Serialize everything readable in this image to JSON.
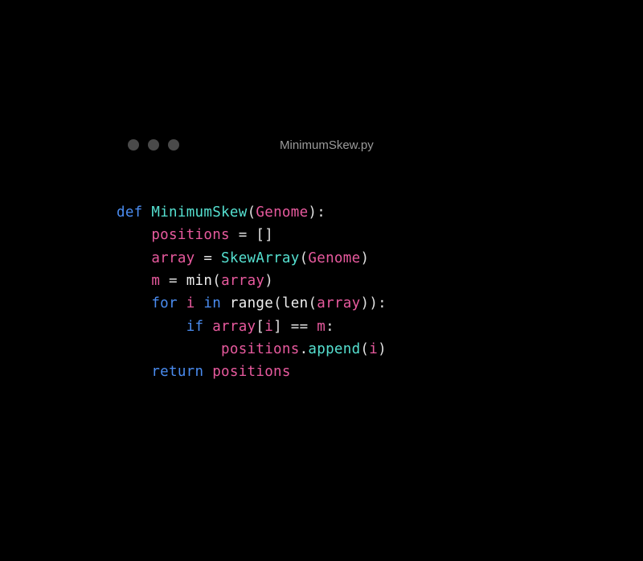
{
  "window": {
    "title": "MinimumSkew.py"
  },
  "code": {
    "line1": {
      "def": "def",
      "fname": "MinimumSkew",
      "lparen": "(",
      "param": "Genome",
      "rparen_colon": "):"
    },
    "line2": {
      "indent": "    ",
      "var": "positions",
      "eq": " = ",
      "brackets": "[]"
    },
    "line3": {
      "indent": "    ",
      "var": "array",
      "eq": " = ",
      "fn": "SkewArray",
      "lparen": "(",
      "arg": "Genome",
      "rparen": ")"
    },
    "line4": {
      "indent": "    ",
      "var": "m",
      "eq": " = ",
      "fn": "min",
      "lparen": "(",
      "arg": "array",
      "rparen": ")"
    },
    "line5": {
      "indent": "    ",
      "for": "for",
      "sp1": " ",
      "i": "i",
      "sp2": " ",
      "in": "in",
      "sp3": " ",
      "range": "range",
      "lparen1": "(",
      "len": "len",
      "lparen2": "(",
      "arr": "array",
      "rparen2": ")",
      "rparen1_colon": "):"
    },
    "line6": {
      "indent": "        ",
      "if": "if",
      "sp": " ",
      "arr": "array",
      "lbracket": "[",
      "i": "i",
      "rbracket": "]",
      "eqeq": " == ",
      "m": "m",
      "colon": ":"
    },
    "line7": {
      "indent": "            ",
      "var": "positions",
      "dot": ".",
      "method": "append",
      "lparen": "(",
      "i": "i",
      "rparen": ")"
    },
    "line8": {
      "indent": "    ",
      "return": "return",
      "sp": " ",
      "var": "positions"
    }
  }
}
